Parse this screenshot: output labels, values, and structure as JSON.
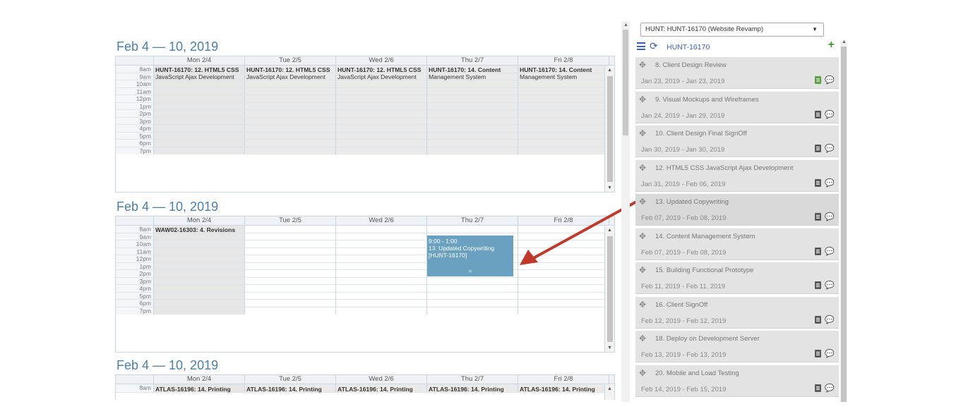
{
  "calendar": {
    "time_labels": [
      "8am",
      "9am",
      "10am",
      "11am",
      "12pm",
      "1pm",
      "2pm",
      "3pm",
      "4pm",
      "5pm",
      "6pm",
      "7pm"
    ],
    "blocks": [
      {
        "title": "Feb 4 — 10, 2019",
        "days": [
          "Mon 2/4",
          "Tue 2/5",
          "Wed 2/6",
          "Thu 2/7",
          "Fri 2/8"
        ],
        "events": [
          {
            "line1": "HUNT-16170: 12. HTML5 CSS",
            "line2": "JavaScript Ajax Development"
          },
          {
            "line1": "HUNT-16170: 12. HTML5 CSS",
            "line2": "JavaScript Ajax Development"
          },
          {
            "line1": "HUNT-16170: 12. HTML5 CSS",
            "line2": "JavaScript Ajax Development"
          },
          {
            "line1": "HUNT-16170: 14. Content",
            "line2": "Management System"
          },
          {
            "line1": "HUNT-16170: 14. Content",
            "line2": "Management System"
          }
        ]
      },
      {
        "title": "Feb 4 — 10, 2019",
        "days": [
          "Mon 2/4",
          "Tue 2/5",
          "Wed 2/6",
          "Thu 2/7",
          "Fri 2/8"
        ],
        "mon_event": "WAW02-16303: 4. Revisions",
        "dropped_event": {
          "time": "9:00 - 1:00",
          "name": "13. Updated Copywriting",
          "code": "[HUNT-16170]",
          "handle": "="
        }
      },
      {
        "title": "Feb 4 — 10, 2019",
        "days": [
          "Mon 2/4",
          "Tue 2/5",
          "Wed 2/6",
          "Thu 2/7",
          "Fri 2/8"
        ],
        "events": [
          "ATLAS-16196: 14. Printing",
          "ATLAS-16196: 14. Printing",
          "ATLAS-16196: 14. Printing",
          "ATLAS-16196: 14. Printing",
          "ATLAS-16196: 14. Printing"
        ]
      }
    ]
  },
  "sidebar": {
    "project_select": "HUNT: HUNT-16170 (Website Revamp)",
    "project_code": "HUNT-16170",
    "tasks": [
      {
        "name": "8. Client Design Review",
        "dates": "Jan 23, 2019 - Jan 23, 2019",
        "doc_green": true
      },
      {
        "name": "9. Visual Mockups and Wireframes",
        "dates": "Jan 24, 2019 - Jan 29, 2019",
        "doc_green": false
      },
      {
        "name": "10. Client Design Final SignOff",
        "dates": "Jan 30, 2019 - Jan 30, 2019",
        "doc_green": false
      },
      {
        "name": "12. HTML5 CSS JavaScript Ajax Development",
        "dates": "Jan 31, 2019 - Feb 06, 2019",
        "doc_green": false
      },
      {
        "name": "13. Updated Copywriting",
        "dates": "Feb 07, 2019 - Feb 08, 2019",
        "doc_green": false
      },
      {
        "name": "14. Content Management System",
        "dates": "Feb 07, 2019 - Feb 08, 2019",
        "doc_green": false
      },
      {
        "name": "15. Building Functional Prototype",
        "dates": "Feb 11, 2019 - Feb 11, 2019",
        "doc_green": false
      },
      {
        "name": "16. Client SignOff",
        "dates": "Feb 12, 2019 - Feb 12, 2019",
        "doc_green": false
      },
      {
        "name": "18. Deploy on Development Server",
        "dates": "Feb 13, 2019 - Feb 13, 2019",
        "doc_green": false
      },
      {
        "name": "20. Mobile and Load Testing",
        "dates": "Feb 14, 2019 - Feb 15, 2019",
        "doc_green": false
      }
    ]
  },
  "colors": {
    "accent": "#3a5fbf",
    "event_blue": "#6aa0c0",
    "arrow": "#c0392b",
    "add_green": "#3c9a2a"
  }
}
